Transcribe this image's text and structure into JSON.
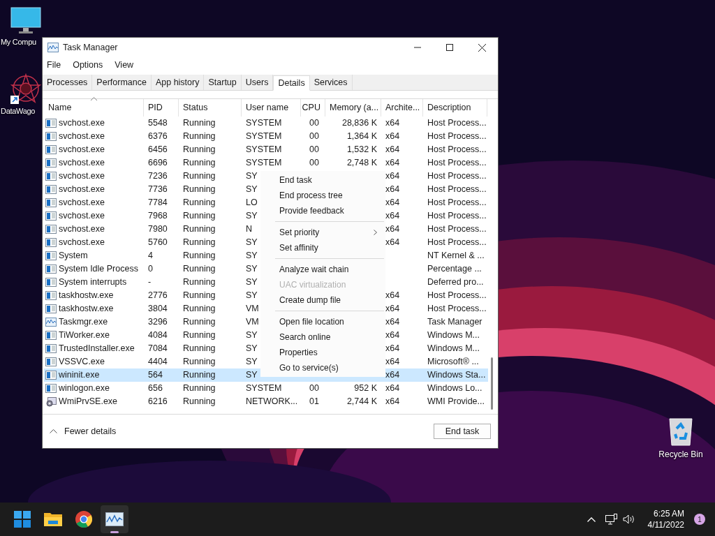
{
  "desktop_icons": [
    {
      "label": "My Compu",
      "kind": "computer"
    },
    {
      "label": "DataWago",
      "kind": "shortcut"
    },
    {
      "label": "Recycle Bin",
      "kind": "recycle"
    }
  ],
  "window": {
    "title": "Task Manager"
  },
  "menu_bar": [
    "File",
    "Options",
    "View"
  ],
  "tabs": [
    {
      "label": "Processes",
      "selected": false
    },
    {
      "label": "Performance",
      "selected": false
    },
    {
      "label": "App history",
      "selected": false
    },
    {
      "label": "Startup",
      "selected": false
    },
    {
      "label": "Users",
      "selected": false
    },
    {
      "label": "Details",
      "selected": true
    },
    {
      "label": "Services",
      "selected": false
    }
  ],
  "table": {
    "columns": [
      "Name",
      "PID",
      "Status",
      "User name",
      "CPU",
      "Memory (a...",
      "Archite...",
      "Description"
    ],
    "rows": [
      {
        "kind": "exe",
        "name": "svchost.exe",
        "pid": "5548",
        "status": "Running",
        "user": "SYSTEM",
        "cpu": "00",
        "memory": "28,836 K",
        "arch": "x64",
        "description": "Host Process...",
        "selected": false
      },
      {
        "kind": "exe",
        "name": "svchost.exe",
        "pid": "6376",
        "status": "Running",
        "user": "SYSTEM",
        "cpu": "00",
        "memory": "1,364 K",
        "arch": "x64",
        "description": "Host Process...",
        "selected": false
      },
      {
        "kind": "exe",
        "name": "svchost.exe",
        "pid": "6456",
        "status": "Running",
        "user": "SYSTEM",
        "cpu": "00",
        "memory": "1,532 K",
        "arch": "x64",
        "description": "Host Process...",
        "selected": false
      },
      {
        "kind": "exe",
        "name": "svchost.exe",
        "pid": "6696",
        "status": "Running",
        "user": "SYSTEM",
        "cpu": "00",
        "memory": "2,748 K",
        "arch": "x64",
        "description": "Host Process...",
        "selected": false
      },
      {
        "kind": "exe",
        "name": "svchost.exe",
        "pid": "7236",
        "status": "Running",
        "user": "SY",
        "arch": "x64",
        "description": "Host Process...",
        "selected": false
      },
      {
        "kind": "exe",
        "name": "svchost.exe",
        "pid": "7736",
        "status": "Running",
        "user": "SY",
        "arch": "x64",
        "description": "Host Process...",
        "selected": false
      },
      {
        "kind": "exe",
        "name": "svchost.exe",
        "pid": "7784",
        "status": "Running",
        "user": "LO",
        "arch": "x64",
        "description": "Host Process...",
        "selected": false
      },
      {
        "kind": "exe",
        "name": "svchost.exe",
        "pid": "7968",
        "status": "Running",
        "user": "SY",
        "arch": "x64",
        "description": "Host Process...",
        "selected": false
      },
      {
        "kind": "exe",
        "name": "svchost.exe",
        "pid": "7980",
        "status": "Running",
        "user": "N",
        "arch": "x64",
        "description": "Host Process...",
        "selected": false
      },
      {
        "kind": "exe",
        "name": "svchost.exe",
        "pid": "5760",
        "status": "Running",
        "user": "SY",
        "arch": "x64",
        "description": "Host Process...",
        "selected": false
      },
      {
        "kind": "exe",
        "name": "System",
        "pid": "4",
        "status": "Running",
        "user": "SY",
        "description": "NT Kernel & ...",
        "selected": false
      },
      {
        "kind": "exe",
        "name": "System Idle Process",
        "pid": "0",
        "status": "Running",
        "user": "SY",
        "description": "Percentage ...",
        "selected": false
      },
      {
        "kind": "exe",
        "name": "System interrupts",
        "pid": "-",
        "status": "Running",
        "user": "SY",
        "description": "Deferred pro...",
        "selected": false
      },
      {
        "kind": "exe",
        "name": "taskhostw.exe",
        "pid": "2776",
        "status": "Running",
        "user": "SY",
        "arch": "x64",
        "description": "Host Process...",
        "selected": false
      },
      {
        "kind": "exe",
        "name": "taskhostw.exe",
        "pid": "3804",
        "status": "Running",
        "user": "VM",
        "arch": "x64",
        "description": "Host Process...",
        "selected": false
      },
      {
        "kind": "graph",
        "name": "Taskmgr.exe",
        "pid": "3296",
        "status": "Running",
        "user": "VM",
        "arch": "x64",
        "description": "Task Manager",
        "selected": false
      },
      {
        "kind": "exe",
        "name": "TiWorker.exe",
        "pid": "4084",
        "status": "Running",
        "user": "SY",
        "arch": "x64",
        "description": "Windows M...",
        "selected": false
      },
      {
        "kind": "exe",
        "name": "TrustedInstaller.exe",
        "pid": "7084",
        "status": "Running",
        "user": "SY",
        "arch": "x64",
        "description": "Windows M...",
        "selected": false
      },
      {
        "kind": "exe",
        "name": "VSSVC.exe",
        "pid": "4404",
        "status": "Running",
        "user": "SY",
        "arch": "x64",
        "description": "Microsoft® ...",
        "selected": false
      },
      {
        "kind": "exe",
        "name": "wininit.exe",
        "pid": "564",
        "status": "Running",
        "user": "SY",
        "arch": "x64",
        "description": "Windows Sta...",
        "selected": true
      },
      {
        "kind": "exe",
        "name": "winlogon.exe",
        "pid": "656",
        "status": "Running",
        "user": "SYSTEM",
        "cpu": "00",
        "memory": "952 K",
        "arch": "x64",
        "description": "Windows Lo...",
        "selected": false
      },
      {
        "kind": "gear",
        "name": "WmiPrvSE.exe",
        "pid": "6216",
        "status": "Running",
        "user": "NETWORK...",
        "cpu": "01",
        "memory": "2,744 K",
        "arch": "x64",
        "description": "WMI Provide...",
        "selected": false
      }
    ]
  },
  "context_menu": [
    {
      "label": "End task",
      "disabled": false
    },
    {
      "label": "End process tree",
      "disabled": false
    },
    {
      "label": "Provide feedback",
      "disabled": false
    },
    {
      "kind": "separator"
    },
    {
      "label": "Set priority",
      "disabled": false,
      "submenu": true
    },
    {
      "label": "Set affinity",
      "disabled": false
    },
    {
      "kind": "separator"
    },
    {
      "label": "Analyze wait chain",
      "disabled": false
    },
    {
      "label": "UAC virtualization",
      "disabled": true
    },
    {
      "label": "Create dump file",
      "disabled": false
    },
    {
      "kind": "separator"
    },
    {
      "label": "Open file location",
      "disabled": false
    },
    {
      "label": "Search online",
      "disabled": false
    },
    {
      "label": "Properties",
      "disabled": false
    },
    {
      "label": "Go to service(s)",
      "disabled": false
    }
  ],
  "footer": {
    "toggle": "Fewer details",
    "button": "End task"
  },
  "taskbar": {
    "apps": [
      {
        "kind": "start",
        "active": false
      },
      {
        "kind": "folder",
        "active": false
      },
      {
        "kind": "browser",
        "active": false
      },
      {
        "kind": "monitor",
        "active": true
      }
    ],
    "time": "6:25 AM",
    "date": "4/11/2022",
    "notifications": "1"
  }
}
